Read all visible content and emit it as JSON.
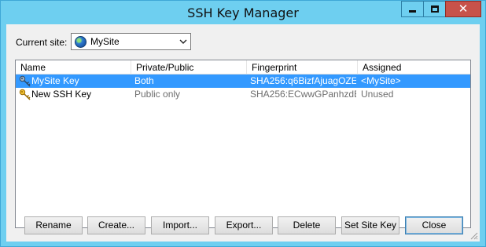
{
  "window": {
    "title": "SSH Key Manager"
  },
  "site": {
    "label": "Current site:",
    "selected": "MySite"
  },
  "list": {
    "columns": [
      "Name",
      "Private/Public",
      "Fingerprint",
      "Assigned"
    ],
    "rows": [
      {
        "name": "MySite Key",
        "type": "Both",
        "fingerprint": "SHA256:q6BizfAjuagOZE...",
        "assigned": "<MySite>",
        "selected": true
      },
      {
        "name": "New SSH Key",
        "type": "Public only",
        "fingerprint": "SHA256:ECwwGPanhzdE...",
        "assigned": "Unused",
        "selected": false
      }
    ]
  },
  "buttons": {
    "rename": "Rename",
    "create": "Create...",
    "import": "Import...",
    "export": "Export...",
    "delete": "Delete",
    "set_site_key": "Set Site Key",
    "close": "Close"
  },
  "colors": {
    "titlebar": "#6ecff0",
    "selection": "#3399ff",
    "close_button": "#c7524a"
  }
}
